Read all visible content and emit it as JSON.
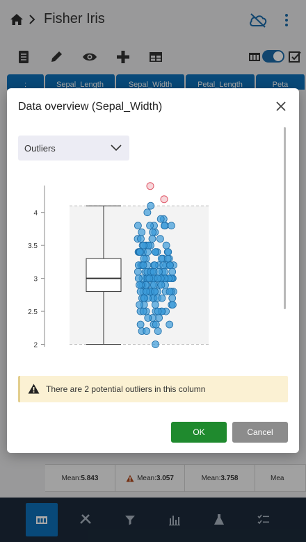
{
  "header": {
    "title": "Fisher Iris"
  },
  "grid": {
    "columns": [
      ":",
      "Sepal_Length",
      "Sepal_Width",
      "Petal_Length",
      "Peta"
    ]
  },
  "stats": {
    "cells": [
      {
        "label": "Mean:",
        "value": "5.843",
        "warning": false
      },
      {
        "label": "Mean:",
        "value": "3.057",
        "warning": true
      },
      {
        "label": "Mean:",
        "value": "3.758",
        "warning": false
      },
      {
        "label": "Mea",
        "value": "",
        "warning": false
      }
    ]
  },
  "dialog": {
    "title": "Data overview (Sepal_Width)",
    "view_select": {
      "value": "Outliers"
    },
    "alert": "There are 2 potential outliers in this column",
    "ok_label": "OK",
    "cancel_label": "Cancel"
  },
  "colors": {
    "primary": "#0d6fb8",
    "ok": "#1f8a2e",
    "cancel": "#8c8c8c",
    "alert_bg": "#fbf1d3",
    "point": "#3a9ad9",
    "outlier": "#e05a6a",
    "nav_bg": "#1c2a3a"
  },
  "chart_data": {
    "type": "scatter",
    "subtype": "boxplot with jittered points",
    "ylim": [
      1.9,
      4.45
    ],
    "yticks": [
      2,
      2.5,
      3,
      3.5,
      4
    ],
    "box": {
      "min": 2.0,
      "q1": 2.8,
      "median": 3.0,
      "q3": 3.3,
      "max": 4.1
    },
    "outliers": [
      4.4,
      4.2
    ],
    "values": [
      2.0,
      2.2,
      2.2,
      2.2,
      2.3,
      2.3,
      2.3,
      2.3,
      2.4,
      2.4,
      2.4,
      2.5,
      2.5,
      2.5,
      2.5,
      2.5,
      2.5,
      2.5,
      2.5,
      2.6,
      2.6,
      2.6,
      2.6,
      2.6,
      2.7,
      2.7,
      2.7,
      2.7,
      2.7,
      2.7,
      2.7,
      2.7,
      2.7,
      2.8,
      2.8,
      2.8,
      2.8,
      2.8,
      2.8,
      2.8,
      2.8,
      2.8,
      2.8,
      2.8,
      2.8,
      2.8,
      2.8,
      2.9,
      2.9,
      2.9,
      2.9,
      2.9,
      2.9,
      2.9,
      2.9,
      2.9,
      2.9,
      3.0,
      3.0,
      3.0,
      3.0,
      3.0,
      3.0,
      3.0,
      3.0,
      3.0,
      3.0,
      3.0,
      3.0,
      3.0,
      3.0,
      3.0,
      3.0,
      3.0,
      3.0,
      3.0,
      3.0,
      3.0,
      3.0,
      3.0,
      3.0,
      3.0,
      3.0,
      3.1,
      3.1,
      3.1,
      3.1,
      3.1,
      3.1,
      3.1,
      3.1,
      3.1,
      3.1,
      3.1,
      3.2,
      3.2,
      3.2,
      3.2,
      3.2,
      3.2,
      3.2,
      3.2,
      3.2,
      3.2,
      3.2,
      3.2,
      3.2,
      3.3,
      3.3,
      3.3,
      3.3,
      3.3,
      3.3,
      3.4,
      3.4,
      3.4,
      3.4,
      3.4,
      3.4,
      3.4,
      3.4,
      3.4,
      3.4,
      3.4,
      3.4,
      3.5,
      3.5,
      3.5,
      3.5,
      3.5,
      3.5,
      3.6,
      3.6,
      3.6,
      3.6,
      3.7,
      3.7,
      3.7,
      3.8,
      3.8,
      3.8,
      3.8,
      3.8,
      3.8,
      3.9,
      3.9,
      4.0,
      4.1
    ],
    "grid": false,
    "legend": "none",
    "xlabel": "",
    "ylabel": ""
  }
}
